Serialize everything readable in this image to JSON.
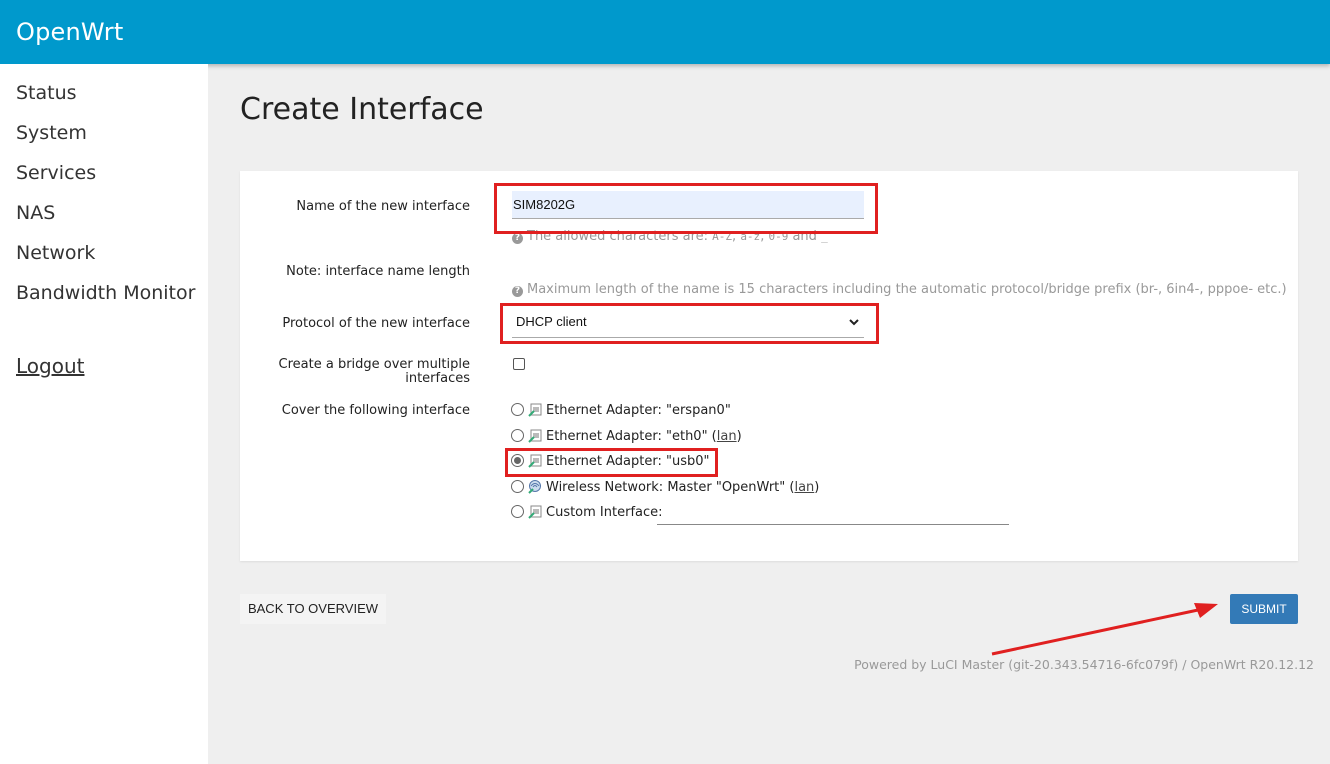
{
  "header": {
    "brand": "OpenWrt"
  },
  "sidebar": {
    "items": [
      {
        "label": "Status"
      },
      {
        "label": "System"
      },
      {
        "label": "Services"
      },
      {
        "label": "NAS"
      },
      {
        "label": "Network"
      },
      {
        "label": "Bandwidth Monitor"
      }
    ],
    "logout": "Logout"
  },
  "page": {
    "title": "Create Interface"
  },
  "form": {
    "name_label": "Name of the new interface",
    "name_value": "SIM8202G",
    "name_hint_prefix": "The allowed characters are: ",
    "name_hint_az": "A-Z",
    "name_hint_az_lower": "a-z",
    "name_hint_09": "0-9",
    "name_hint_and": " and ",
    "name_hint_underscore": "_",
    "note_label": "Note: interface name length",
    "note_hint": "Maximum length of the name is 15 characters including the automatic protocol/bridge prefix (br-, 6in4-, pppoe- etc.)",
    "protocol_label": "Protocol of the new interface",
    "protocol_value": "DHCP client",
    "bridge_label_line1": "Create a bridge over multiple",
    "bridge_label_line2": "interfaces",
    "bridge_checked": false,
    "cover_label": "Cover the following interface",
    "cover_options": [
      {
        "text": "Ethernet Adapter: \"erspan0\"",
        "link": "",
        "selected": false,
        "icon": "ethernet-icon"
      },
      {
        "text": "Ethernet Adapter: \"eth0\" (",
        "link": "lan",
        "suffix": ")",
        "selected": false,
        "icon": "ethernet-icon"
      },
      {
        "text": "Ethernet Adapter: \"usb0\"",
        "link": "",
        "selected": true,
        "icon": "ethernet-icon"
      },
      {
        "text": "Wireless Network: Master \"OpenWrt\" (",
        "link": "lan",
        "suffix": ")",
        "selected": false,
        "icon": "wifi-icon"
      },
      {
        "text": "Custom Interface:",
        "link": "",
        "selected": false,
        "icon": "ethernet-icon"
      }
    ]
  },
  "actions": {
    "back": "BACK TO OVERVIEW",
    "submit": "SUBMIT"
  },
  "footer": {
    "text": "Powered by LuCI Master (git-20.343.54716-6fc079f) / OpenWrt R20.12.12"
  },
  "colors": {
    "header": "#0099cc",
    "submit": "#337ab7",
    "annotation": "#e02020"
  }
}
